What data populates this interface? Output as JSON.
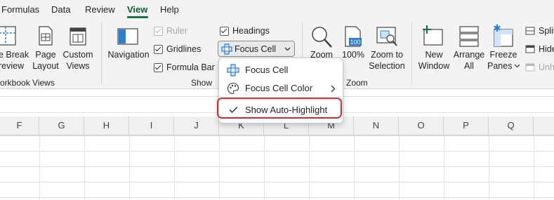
{
  "tabs": [
    {
      "label": "Formulas",
      "active": false
    },
    {
      "label": "Data",
      "active": false
    },
    {
      "label": "Review",
      "active": false
    },
    {
      "label": "View",
      "active": true
    },
    {
      "label": "Help",
      "active": false
    }
  ],
  "ribbon": {
    "workbook_views": {
      "page_break_line1": "e Break",
      "page_break_line2": "review",
      "page_layout_line1": "Page",
      "page_layout_line2": "Layout",
      "custom_views_line1": "Custom",
      "custom_views_line2": "Views",
      "group_label": "orkbook Views"
    },
    "show": {
      "navigation": "Navigation",
      "ruler": "Ruler",
      "gridlines": "Gridlines",
      "formula_bar": "Formula Bar",
      "headings": "Headings",
      "focus_cell": "Focus Cell",
      "group_label": "Show"
    },
    "zoom": {
      "zoom": "Zoom",
      "zoom_100": "100%",
      "zoom_selection_line1": "Zoom to",
      "zoom_selection_line2": "Selection",
      "icon_100": "100",
      "group_label": "Zoom"
    },
    "window": {
      "new_window_line1": "New",
      "new_window_line2": "Window",
      "arrange_line1": "Arrange",
      "arrange_line2": "All",
      "freeze_line1": "Freeze",
      "freeze_line2": "Panes",
      "split": "Split",
      "hide": "Hide",
      "unhide": "Unh"
    }
  },
  "focus_cell_menu": {
    "items": [
      {
        "label": "Focus Cell"
      },
      {
        "label": "Focus Cell Color"
      },
      {
        "label": "Show Auto-Highlight"
      }
    ]
  },
  "columns": [
    "F",
    "G",
    "H",
    "I",
    "J",
    "K",
    "L",
    "M",
    "N",
    "O",
    "P",
    "Q"
  ],
  "colors": {
    "accent_green": "#1e7145",
    "highlight_red": "#d42a35",
    "icon_blue": "#2b7cd3"
  }
}
